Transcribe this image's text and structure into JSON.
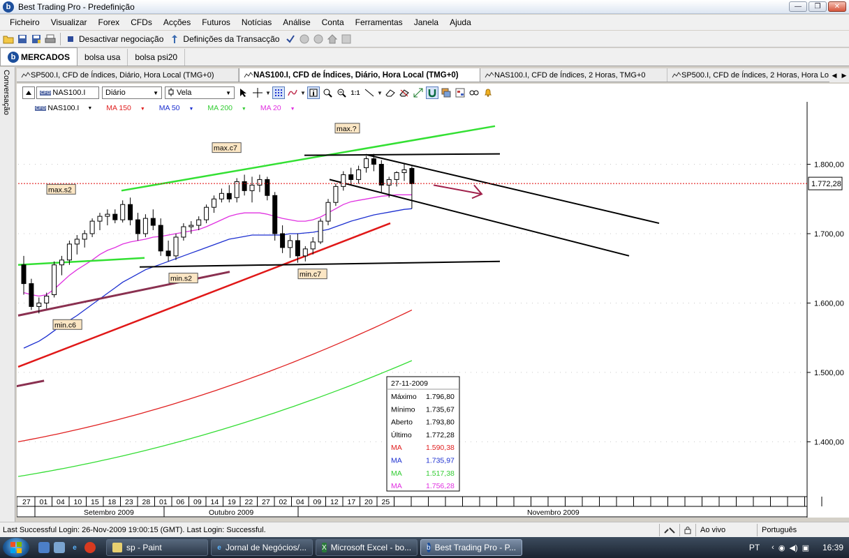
{
  "window": {
    "title": "Best Trading Pro - Predefinição",
    "app_icon_letter": "b",
    "minimize": "—",
    "maximize": "❐",
    "close": "✕"
  },
  "menu": [
    "Ficheiro",
    "Visualizar",
    "Forex",
    "CFDs",
    "Acções",
    "Futuros",
    "Notícias",
    "Análise",
    "Conta",
    "Ferramentas",
    "Janela",
    "Ajuda"
  ],
  "toolbar": {
    "deactivate_label": "Desactivar negociação",
    "settings_label": "Definições da Transacção"
  },
  "workspace_tabs": [
    "MERCADOS",
    "bolsa usa",
    "bolsa psi20"
  ],
  "side_panel_label": "Conversação",
  "chart_tabs": [
    "SP500.I, CFD de Índices, Diário, Hora Local (TMG+0)",
    "NAS100.I, CFD de Índices, Diário, Hora Local (TMG+0)",
    "NAS100.I, CFD de Índices, 2 Horas, TMG+0",
    "SP500.I, CFD de Índices, 2 Horas, Hora Lo"
  ],
  "chart_toolbar": {
    "symbol": "NAS100.I",
    "symbol_badge": "CFD",
    "timeframe": "Diário",
    "chart_type": "Vela"
  },
  "legend": {
    "symbol": "NAS100.I",
    "items": [
      "MA 150",
      "MA 50",
      "MA 200",
      "MA 20"
    ]
  },
  "colors": {
    "ma150": "#e02020",
    "ma50": "#1c2fd0",
    "ma200": "#33dd33",
    "ma20": "#e030e0",
    "trend_green": "#33e033",
    "trend_red": "#e01818",
    "trend_purple": "#8a3050",
    "price_line": "#e00000"
  },
  "chart_data": {
    "type": "candlestick",
    "price_axis": {
      "ticks": [
        "1.800,00",
        "1.700,00",
        "1.600,00",
        "1.500,00",
        "1.400,00"
      ],
      "current_price_label": "1.772,28",
      "current_price": 1772.28,
      "range": [
        1325,
        1890
      ]
    },
    "date_ticks": [
      "27",
      "01",
      "04",
      "10",
      "15",
      "18",
      "23",
      "28",
      "01",
      "06",
      "09",
      "14",
      "19",
      "22",
      "27",
      "02",
      "04",
      "09",
      "12",
      "17",
      "20",
      "25"
    ],
    "months": [
      "Setembro 2009",
      "Outubro 2009",
      "Novembro 2009"
    ],
    "annotations": [
      "max.?",
      "max.c7",
      "max.s2",
      "min.s2",
      "min.c7",
      "min.c6"
    ],
    "info_box": {
      "date": "27-11-2009",
      "rows": [
        {
          "label": "Máximo",
          "value": "1.796,80",
          "color": "#000000"
        },
        {
          "label": "Mínimo",
          "value": "1.735,67",
          "color": "#000000"
        },
        {
          "label": "Aberto",
          "value": "1.793,80",
          "color": "#000000"
        },
        {
          "label": "Último",
          "value": "1.772,28",
          "color": "#000000"
        },
        {
          "label": "MA",
          "value": "1.590,38",
          "color": "#e02020"
        },
        {
          "label": "MA",
          "value": "1.735,97",
          "color": "#1c2fd0"
        },
        {
          "label": "MA",
          "value": "1.517,38",
          "color": "#33cc33"
        },
        {
          "label": "MA",
          "value": "1.756,28",
          "color": "#e030e0"
        }
      ]
    },
    "candles": [
      [
        1655,
        1668,
        1612,
        1628
      ],
      [
        1628,
        1635,
        1590,
        1595
      ],
      [
        1595,
        1608,
        1585,
        1600
      ],
      [
        1600,
        1615,
        1592,
        1610
      ],
      [
        1612,
        1660,
        1608,
        1655
      ],
      [
        1655,
        1668,
        1640,
        1662
      ],
      [
        1662,
        1690,
        1655,
        1685
      ],
      [
        1685,
        1698,
        1670,
        1692
      ],
      [
        1692,
        1705,
        1680,
        1700
      ],
      [
        1700,
        1722,
        1695,
        1718
      ],
      [
        1718,
        1730,
        1705,
        1725
      ],
      [
        1725,
        1735,
        1712,
        1728
      ],
      [
        1728,
        1735,
        1715,
        1720
      ],
      [
        1720,
        1748,
        1716,
        1742
      ],
      [
        1742,
        1752,
        1712,
        1720
      ],
      [
        1720,
        1730,
        1690,
        1700
      ],
      [
        1700,
        1728,
        1695,
        1722
      ],
      [
        1722,
        1735,
        1705,
        1712
      ],
      [
        1712,
        1722,
        1668,
        1675
      ],
      [
        1675,
        1690,
        1660,
        1668
      ],
      [
        1668,
        1700,
        1662,
        1695
      ],
      [
        1695,
        1715,
        1690,
        1710
      ],
      [
        1710,
        1718,
        1700,
        1712
      ],
      [
        1712,
        1725,
        1705,
        1720
      ],
      [
        1720,
        1742,
        1715,
        1738
      ],
      [
        1738,
        1755,
        1730,
        1750
      ],
      [
        1750,
        1765,
        1745,
        1758
      ],
      [
        1758,
        1770,
        1745,
        1750
      ],
      [
        1752,
        1780,
        1745,
        1775
      ],
      [
        1775,
        1785,
        1755,
        1762
      ],
      [
        1762,
        1782,
        1745,
        1770
      ],
      [
        1770,
        1785,
        1760,
        1778
      ],
      [
        1778,
        1782,
        1748,
        1755
      ],
      [
        1755,
        1760,
        1690,
        1700
      ],
      [
        1700,
        1712,
        1672,
        1680
      ],
      [
        1680,
        1698,
        1665,
        1690
      ],
      [
        1690,
        1700,
        1658,
        1668
      ],
      [
        1668,
        1682,
        1660,
        1678
      ],
      [
        1678,
        1695,
        1670,
        1688
      ],
      [
        1688,
        1722,
        1685,
        1718
      ],
      [
        1718,
        1750,
        1712,
        1745
      ],
      [
        1745,
        1772,
        1740,
        1768
      ],
      [
        1768,
        1790,
        1762,
        1785
      ],
      [
        1785,
        1795,
        1770,
        1778
      ],
      [
        1778,
        1798,
        1772,
        1792
      ],
      [
        1795,
        1812,
        1788,
        1808
      ],
      [
        1808,
        1815,
        1790,
        1800
      ],
      [
        1800,
        1806,
        1760,
        1770
      ],
      [
        1770,
        1782,
        1752,
        1778
      ],
      [
        1778,
        1790,
        1768,
        1788
      ],
      [
        1788,
        1800,
        1776,
        1792
      ],
      [
        1794,
        1797,
        1736,
        1772
      ]
    ],
    "ma20": [
      1615,
      1612,
      1610,
      1612,
      1620,
      1630,
      1640,
      1648,
      1655,
      1662,
      1670,
      1676,
      1680,
      1685,
      1688,
      1690,
      1692,
      1695,
      1696,
      1698,
      1700,
      1702,
      1704,
      1706,
      1710,
      1715,
      1720,
      1725,
      1728,
      1730,
      1730,
      1730,
      1728,
      1725,
      1722,
      1720,
      1718,
      1718,
      1720,
      1724,
      1730,
      1736,
      1742,
      1746,
      1748,
      1750,
      1752,
      1754,
      1755,
      1756,
      1756,
      1756
    ],
    "ma50": [
      1535,
      1540,
      1545,
      1552,
      1560,
      1568,
      1575,
      1582,
      1590,
      1598,
      1606,
      1614,
      1622,
      1630,
      1636,
      1642,
      1648,
      1652,
      1656,
      1660,
      1664,
      1668,
      1672,
      1676,
      1680,
      1684,
      1688,
      1692,
      1694,
      1696,
      1698,
      1698,
      1698,
      1698,
      1698,
      1700,
      1700,
      1701,
      1702,
      1704,
      1706,
      1710,
      1714,
      1718,
      1721,
      1724,
      1727,
      1729,
      1731,
      1733,
      1735,
      1736
    ],
    "ma150": [
      1400,
      1590
    ],
    "ma200": [
      1350,
      1517
    ]
  },
  "status": {
    "text": "Last Successful Login: 26-Nov-2009 19:00:15 (GMT). Last Login: Successful.",
    "live": "Ao vivo",
    "language": "Português"
  },
  "taskbar": {
    "items": [
      "sp - Paint",
      "Jornal de Negócios/...",
      "Microsoft Excel - bo...",
      "Best Trading Pro - P..."
    ],
    "lang": "PT",
    "clock": "16:39"
  }
}
